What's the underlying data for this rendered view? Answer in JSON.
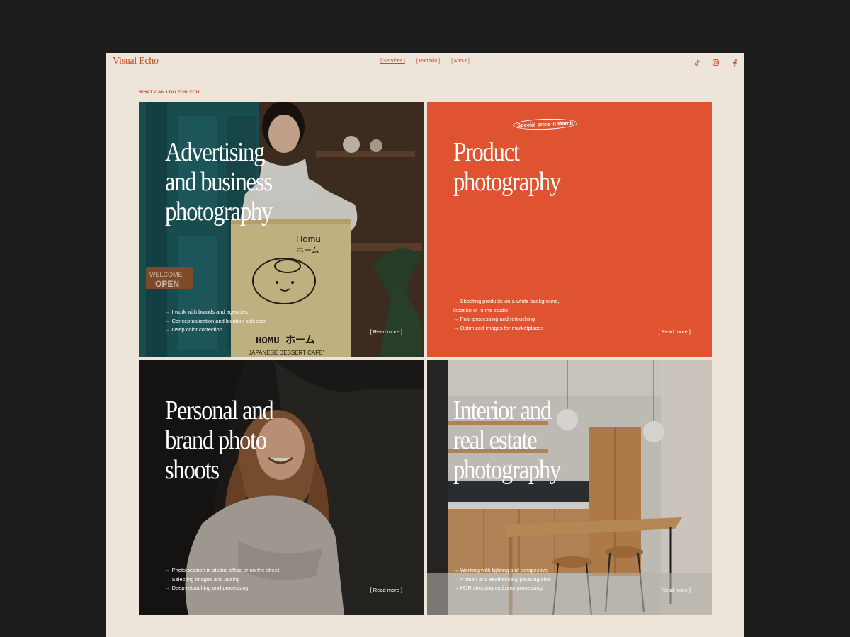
{
  "header": {
    "logo": "Visual Echo",
    "nav": [
      "[ Services ]",
      "[ Portfolio ]",
      "[ About ]"
    ],
    "social_icons": [
      "tiktok-icon",
      "instagram-icon",
      "facebook-icon"
    ]
  },
  "section": {
    "eyebrow": "WHAT CAN I DO FOR YOU"
  },
  "cards": [
    {
      "title": "Advertising\nand business\nphotography",
      "bullets": [
        "I work with brands and agencies",
        "Conceptualization and location selection",
        "Deep color correction"
      ],
      "read_more": "[ Read more ]",
      "photo_text": {
        "sign_top": "Homu\nホーム",
        "sign_bottom": "HOMU ホーム",
        "sign_caption": "JAPANESE DESSERT CAFE'",
        "door_sign": "WELCOME\nOPEN"
      }
    },
    {
      "badge": "Special price in March",
      "title": "Product\nphotography",
      "bullets": [
        "Shooting products on a white background,\nlocation or in the studio",
        "Post-processing and retouching",
        "Optimized images for marketplaces"
      ],
      "read_more": "[ Read more ]",
      "color": "#e05330"
    },
    {
      "title": "Personal and\nbrand photo\nshoots",
      "bullets": [
        "Photo session in studio, office or on the street",
        "Selecting images and posing",
        "Deep retouching and processing"
      ],
      "read_more": "[ Read more ]"
    },
    {
      "title": "Interior and\nreal estate\nphotography",
      "bullets": [
        "Working with lighting and perspective",
        "A clean and aesthetically pleasing shot",
        "HDR shooting and post-processing"
      ],
      "read_more": "[ Read more ]"
    }
  ]
}
